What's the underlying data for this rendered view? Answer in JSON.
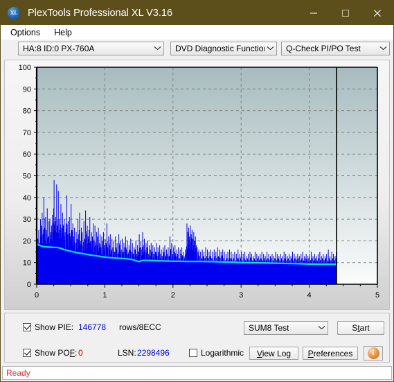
{
  "window": {
    "title": "PlexTools Professional XL V3.16",
    "icon": "xl-logo-icon",
    "titlebar_color": "#5c4f1c",
    "minimize_label": "—",
    "maximize_label": "□",
    "close_label": "✕"
  },
  "menu": {
    "items": [
      {
        "label": "Options"
      },
      {
        "label": "Help"
      }
    ]
  },
  "toolbar": {
    "drive_select": {
      "value": "HA:8 ID:0  PX-760A",
      "arrow": "∨"
    },
    "function_select": {
      "value": "DVD Diagnostic Functions",
      "arrow": "∨"
    },
    "test_select": {
      "value": "Q-Check PI/PO Test",
      "arrow": "∨"
    }
  },
  "controls": {
    "show_pie": {
      "label_pre": "Show PIE:",
      "checked": true,
      "value": "146778",
      "units": "rows/8ECC"
    },
    "show_pof": {
      "label_pre": "Show PO",
      "label_underline": "F",
      "label_post": ":",
      "checked": true,
      "value": "0"
    },
    "lsn": {
      "label": "LSN:",
      "value": "2298496"
    },
    "logarithmic": {
      "label": "Logarithmic",
      "checked": false
    },
    "sum_select": {
      "value": "SUM8 Test",
      "arrow": "∨"
    },
    "start_button": {
      "pre": "S",
      "accel": "t",
      "post": "art",
      "label": "Start"
    },
    "view_log_button": {
      "accel": "V",
      "post": "iew Log",
      "label": "View Log"
    },
    "preferences_button": {
      "accel": "P",
      "post": "references",
      "label": "Preferences"
    },
    "info_button": {
      "glyph": "i",
      "name": "info-icon"
    }
  },
  "status": {
    "text": "Ready"
  },
  "chart_data": {
    "type": "area",
    "title": "",
    "xlabel": "",
    "ylabel": "",
    "xlim": [
      0,
      5
    ],
    "ylim": [
      0,
      100
    ],
    "xticks": [
      0,
      1,
      2,
      3,
      4,
      5
    ],
    "yticks": [
      0,
      10,
      20,
      30,
      40,
      50,
      60,
      70,
      80,
      90,
      100
    ],
    "grid": true,
    "legend": "none",
    "colors": {
      "pie_bars": "#0000ee",
      "pie_average": "#00e5ff",
      "plot_bg_top": "#a7bcbf",
      "plot_bg_bottom": "#fbfcfc",
      "axis": "#000000",
      "gridline": "#808080"
    },
    "data_end_x": 4.4,
    "marker_line_x": 4.4,
    "series": [
      {
        "name": "PIE max (spikes)",
        "color": "#0000ee",
        "x_step": 0.0125,
        "values": [
          37,
          21,
          25,
          19,
          30,
          27,
          33,
          23,
          40,
          26,
          31,
          25,
          35,
          22,
          29,
          30,
          24,
          27,
          32,
          28,
          48,
          29,
          31,
          46,
          27,
          43,
          30,
          25,
          37,
          26,
          33,
          27,
          30,
          24,
          28,
          41,
          23,
          29,
          31,
          22,
          37,
          25,
          28,
          22,
          26,
          19,
          24,
          21,
          30,
          23,
          33,
          20,
          26,
          24,
          18,
          29,
          21,
          34,
          23,
          27,
          22,
          25,
          31,
          19,
          24,
          22,
          28,
          20,
          27,
          18,
          24,
          22,
          26,
          19,
          23,
          17,
          22,
          20,
          24,
          18,
          21,
          19,
          28,
          17,
          22,
          18,
          23,
          16,
          21,
          17,
          20,
          15,
          22,
          17,
          19,
          14,
          23,
          18,
          20,
          16,
          21,
          15,
          19,
          17,
          22,
          16,
          20,
          14,
          18,
          16,
          21,
          15,
          19,
          14,
          17,
          16,
          20,
          14,
          18,
          15,
          23,
          17,
          20,
          16,
          24,
          18,
          21,
          15,
          19,
          17,
          20,
          14,
          18,
          16,
          19,
          15,
          18,
          14,
          17,
          15,
          19,
          13,
          17,
          15,
          18,
          14,
          16,
          13,
          17,
          15,
          18,
          13,
          16,
          14,
          17,
          13,
          22,
          16,
          19,
          14,
          17,
          15,
          18,
          13,
          16,
          14,
          17,
          12,
          16,
          14,
          17,
          13,
          15,
          12,
          16,
          14,
          28,
          24,
          26,
          22,
          27,
          23,
          25,
          21,
          24,
          20,
          22,
          18,
          17,
          15,
          16,
          13,
          15,
          12,
          16,
          13,
          15,
          12,
          17,
          13,
          16,
          12,
          15,
          13,
          16,
          12,
          15,
          11,
          16,
          13,
          15,
          12,
          17,
          13,
          16,
          12,
          15,
          13,
          16,
          12,
          15,
          11,
          14,
          12,
          15,
          11,
          16,
          12,
          15,
          11,
          14,
          12,
          15,
          11,
          14,
          12,
          16,
          11,
          14,
          12,
          15,
          11,
          14,
          12,
          15,
          11,
          13,
          12,
          14,
          11,
          15,
          12,
          14,
          11,
          13,
          12,
          15,
          11,
          14,
          12,
          13,
          11,
          14,
          12,
          15,
          11,
          14,
          12,
          13,
          11,
          15,
          12,
          14,
          11,
          13,
          12,
          14,
          11,
          13,
          12,
          15,
          11,
          14,
          12,
          13,
          11,
          14,
          12,
          13,
          11,
          15,
          12,
          14,
          11,
          13,
          12,
          14,
          11,
          13,
          12,
          15,
          11,
          14,
          12,
          13,
          11,
          14,
          12,
          13,
          11,
          14,
          12,
          15,
          11,
          13,
          12,
          14,
          11,
          13,
          12,
          14,
          11,
          15,
          12,
          13,
          11,
          14,
          12,
          13,
          11,
          14,
          12,
          15,
          11,
          13,
          12,
          14,
          11,
          13,
          12,
          14,
          11,
          16,
          12,
          13,
          11,
          15,
          12,
          14,
          11,
          13,
          12,
          15,
          11,
          14,
          12,
          13,
          11,
          14,
          12,
          13,
          11,
          15,
          12,
          14,
          11,
          13,
          12,
          14,
          11,
          13,
          12
        ],
        "note": "vertical spike heights, index i at x = i * 0.0125"
      },
      {
        "name": "PIE average",
        "color": "#00e5ff",
        "x": [
          0.0,
          0.05,
          0.1,
          0.15,
          0.2,
          0.25,
          0.3,
          0.35,
          0.4,
          0.5,
          0.6,
          0.7,
          0.8,
          0.9,
          1.0,
          1.1,
          1.2,
          1.3,
          1.4,
          1.5,
          1.55,
          1.6,
          1.7,
          1.8,
          1.9,
          2.0,
          2.2,
          2.4,
          2.6,
          2.8,
          3.0,
          3.2,
          3.4,
          3.6,
          3.8,
          4.0,
          4.2,
          4.4
        ],
        "values": [
          18.5,
          17.8,
          17.4,
          17.2,
          17.1,
          17.0,
          17.0,
          16.6,
          16.0,
          15.2,
          14.5,
          14.0,
          13.4,
          13.0,
          12.5,
          12.2,
          12.0,
          11.8,
          11.4,
          10.4,
          11.0,
          11.0,
          10.9,
          10.8,
          10.7,
          10.6,
          10.5,
          10.5,
          10.4,
          10.2,
          10.0,
          9.9,
          9.8,
          9.6,
          9.5,
          9.3,
          9.2,
          9.2
        ]
      },
      {
        "name": "PIE baseline fill",
        "color": "#0000ee",
        "description": "solid blue fill from 0 up to the average envelope across full scanned span"
      }
    ]
  }
}
